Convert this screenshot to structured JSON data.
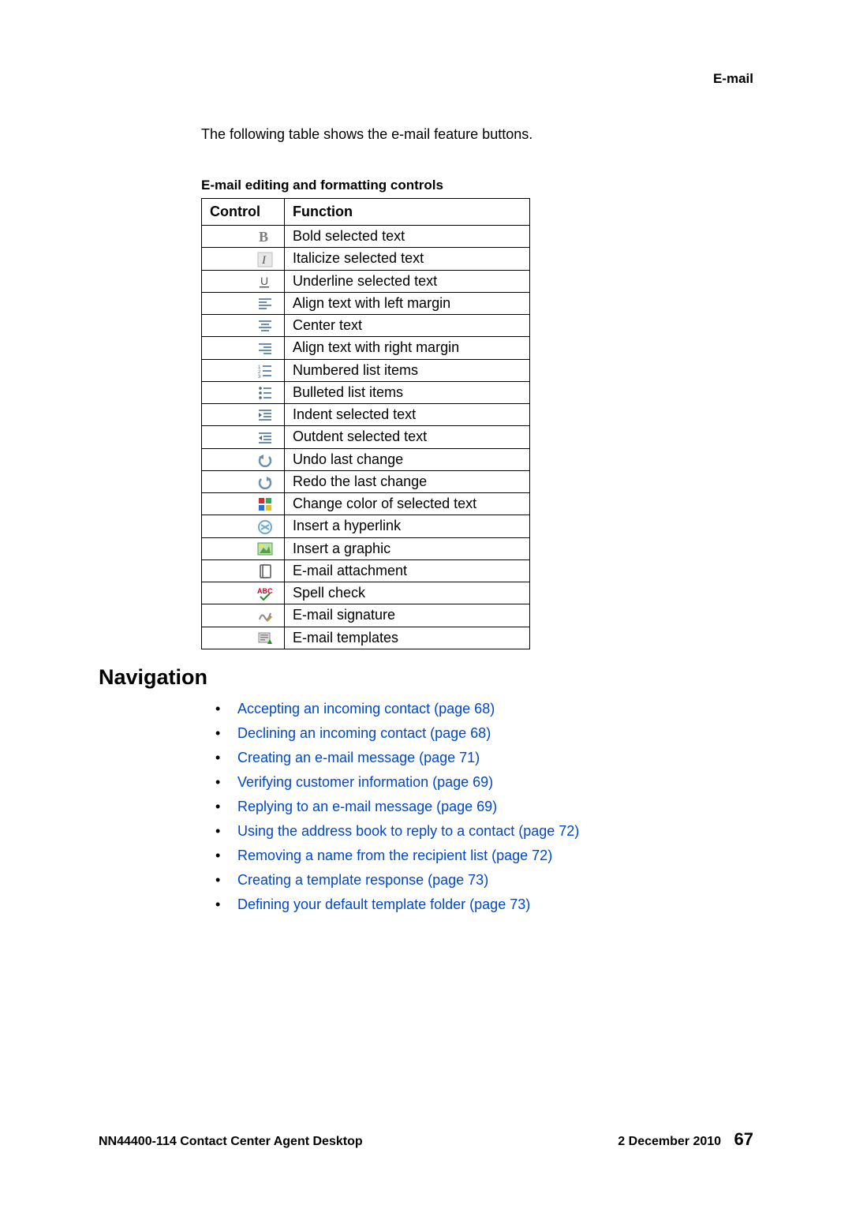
{
  "header": {
    "section": "E-mail"
  },
  "intro": "The following table shows the e-mail feature buttons.",
  "table": {
    "caption": "E-mail editing and formatting controls",
    "headers": {
      "control": "Control",
      "function": "Function"
    },
    "rows": [
      {
        "icon": "bold-icon",
        "fn": "Bold selected text"
      },
      {
        "icon": "italic-icon",
        "fn": "Italicize selected text"
      },
      {
        "icon": "underline-icon",
        "fn": "Underline selected text"
      },
      {
        "icon": "align-left-icon",
        "fn": "Align text with left margin"
      },
      {
        "icon": "align-center-icon",
        "fn": "Center text"
      },
      {
        "icon": "align-right-icon",
        "fn": "Align text with right margin"
      },
      {
        "icon": "numbered-list-icon",
        "fn": "Numbered list items"
      },
      {
        "icon": "bulleted-list-icon",
        "fn": "Bulleted list items"
      },
      {
        "icon": "indent-icon",
        "fn": "Indent selected text"
      },
      {
        "icon": "outdent-icon",
        "fn": "Outdent selected text"
      },
      {
        "icon": "undo-icon",
        "fn": "Undo last change"
      },
      {
        "icon": "redo-icon",
        "fn": "Redo the last change"
      },
      {
        "icon": "font-color-icon",
        "fn": "Change color of selected text"
      },
      {
        "icon": "hyperlink-icon",
        "fn": "Insert a hyperlink"
      },
      {
        "icon": "insert-image-icon",
        "fn": "Insert a graphic"
      },
      {
        "icon": "attachment-icon",
        "fn": "E-mail attachment"
      },
      {
        "icon": "spellcheck-icon",
        "fn": "Spell check"
      },
      {
        "icon": "signature-icon",
        "fn": "E-mail signature"
      },
      {
        "icon": "templates-icon",
        "fn": "E-mail templates"
      }
    ]
  },
  "navigation": {
    "heading": "Navigation",
    "items": [
      "Accepting an incoming contact (page 68)",
      "Declining an incoming contact (page 68)",
      "Creating an e-mail message (page 71)",
      "Verifying customer information (page 69)",
      "Replying to an e-mail message (page 69)",
      "Using the address book to reply to a contact (page 72)",
      "Removing a name from the recipient list (page 72)",
      "Creating a template response (page 73)",
      "Defining your default template folder (page 73)"
    ]
  },
  "footer": {
    "left": "NN44400-114 Contact Center Agent Desktop",
    "date": "2 December 2010",
    "page": "67"
  }
}
